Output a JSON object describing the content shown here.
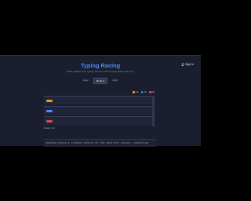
{
  "header": {
    "title": "Typing Racing",
    "subtitle": "Race against AI by typing. Find out who's typing faster than you!",
    "signin_icon": "user-icon",
    "signin_label": "Sign In"
  },
  "modes": [
    {
      "label": "Easy",
      "active": false
    },
    {
      "label": "Medium",
      "active": true
    },
    {
      "label": "Hard",
      "active": false
    }
  ],
  "legend": [
    {
      "label": "You",
      "color": "#f39a2a"
    },
    {
      "label": "AI1",
      "color": "#4f8cf6"
    },
    {
      "label": "AI2",
      "color": "#e5485f"
    }
  ],
  "racers": [
    {
      "name": "You",
      "color": "#f39a2a",
      "progress": 0
    },
    {
      "name": "AI1",
      "color": "#4f8cf6",
      "progress": 0
    },
    {
      "name": "AI2",
      "color": "#e5485f",
      "progress": 0
    }
  ],
  "status": "Ready. Go!",
  "passage": "Quantum physics studies nature at the smallest scales, revealing"
}
